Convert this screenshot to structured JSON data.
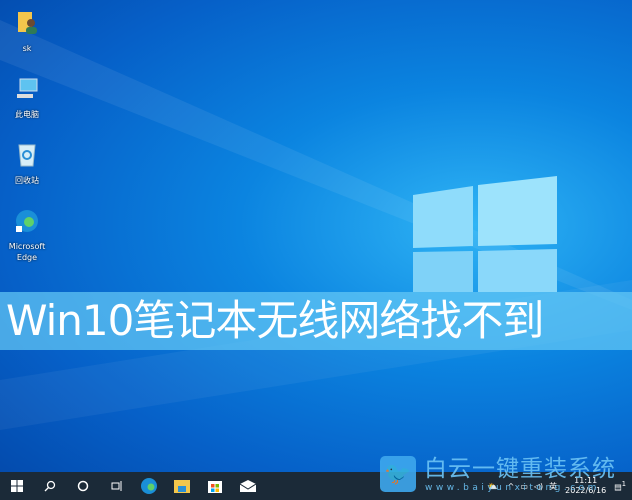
{
  "desktop": {
    "icons": [
      {
        "label": "sk",
        "icon": "user-folder-icon"
      },
      {
        "label": "此电脑",
        "icon": "computer-icon"
      },
      {
        "label": "回收站",
        "icon": "recycle-bin-icon"
      },
      {
        "label": "Microsoft Edge",
        "icon": "edge-icon"
      }
    ]
  },
  "banner": {
    "title": "Win10笔记本无线网络找不到"
  },
  "watermark": {
    "name": "白云一键重装系统",
    "url": "www.baiyunxitong.com"
  },
  "taskbar": {
    "items": [
      "start",
      "search",
      "cortana",
      "task-view",
      "edge",
      "file-explorer",
      "store",
      "mail"
    ],
    "tray": {
      "ime": "英",
      "time": "11:11",
      "date": "2022/6/16",
      "notifications": "1"
    }
  }
}
